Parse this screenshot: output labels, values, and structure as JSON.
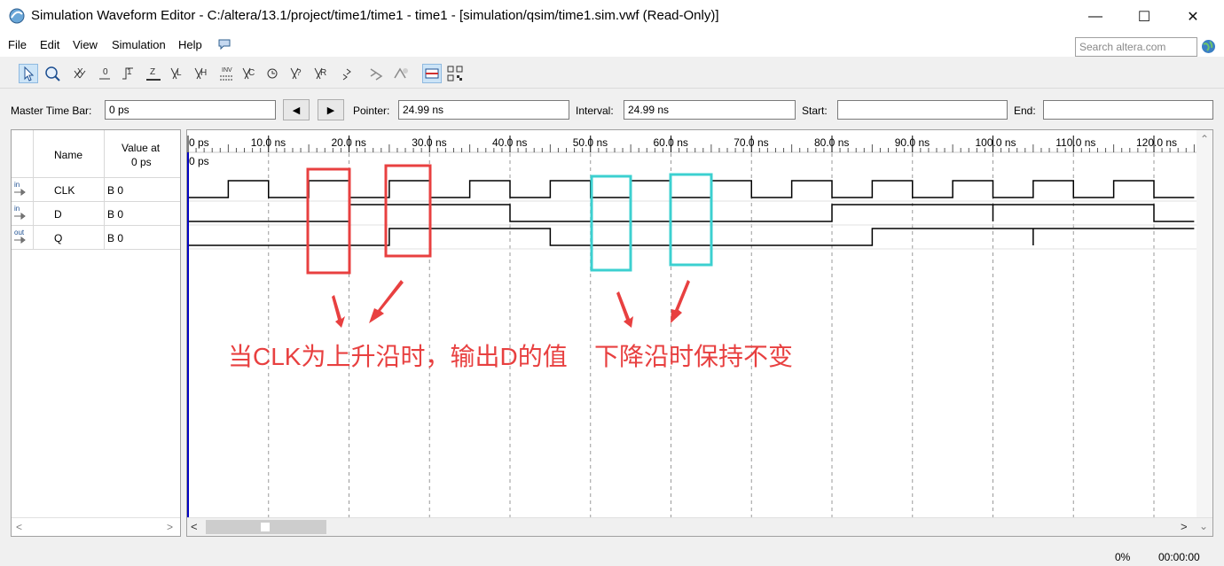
{
  "window": {
    "title": "Simulation Waveform Editor - C:/altera/13.1/project/time1/time1 - time1 - [simulation/qsim/time1.sim.vwf (Read-Only)]",
    "minimize": "—",
    "maximize": "☐",
    "close": "✕"
  },
  "menu": {
    "file": "File",
    "edit": "Edit",
    "view": "View",
    "simulation": "Simulation",
    "help": "Help",
    "search_placeholder": "Search altera.com"
  },
  "toolbar": {
    "icons": [
      "select-icon",
      "zoom-icon",
      "force-unknown-icon",
      "force-low-icon",
      "force-high-icon",
      "force-high-z-icon",
      "force-weak-low-icon",
      "force-weak-high-icon",
      "invert-icon",
      "count-value-icon",
      "clock-icon",
      "random-icon",
      "arbitrary-value-icon",
      "functional-sim-icon",
      "timing-sim-icon",
      "netlist-icon",
      "snap-to-grid-icon",
      "grid-icon"
    ],
    "texts": [
      "X",
      "0",
      "1",
      "Z",
      "L",
      "H",
      "INV",
      "C",
      "?",
      "R"
    ]
  },
  "timebar": {
    "master_label": "Master Time Bar:",
    "master_value": "0 ps",
    "prev": "◀",
    "next": "▶",
    "pointer_label": "Pointer:",
    "pointer_value": "24.99 ns",
    "interval_label": "Interval:",
    "interval_value": "24.99 ns",
    "start_label": "Start:",
    "start_value": "",
    "end_label": "End:",
    "end_value": ""
  },
  "signal_table": {
    "header_name": "Name",
    "header_value_line1": "Value at",
    "header_value_line2": "0 ps",
    "rows": [
      {
        "dir": "in",
        "name": "CLK",
        "value": "B 0"
      },
      {
        "dir": "in",
        "name": "D",
        "value": "B 0"
      },
      {
        "dir": "out",
        "name": "Q",
        "value": "B 0"
      }
    ]
  },
  "waveform": {
    "time_labels": [
      "0 ps",
      "10.0 ns",
      "20.0 ns",
      "30.0 ns",
      "40.0 ns",
      "50.0 ns",
      "60.0 ns",
      "70.0 ns",
      "80.0 ns",
      "90.0 ns",
      "100.0 ns",
      "110.0 ns",
      "120.0 ns"
    ],
    "cursor_label": "0 ps",
    "time_unit": "ns",
    "time_max": 125,
    "signals": {
      "CLK": [
        [
          0,
          0
        ],
        [
          5,
          1
        ],
        [
          10,
          0
        ],
        [
          15,
          1
        ],
        [
          20,
          0
        ],
        [
          25,
          1
        ],
        [
          30,
          0
        ],
        [
          35,
          1
        ],
        [
          40,
          0
        ],
        [
          45,
          1
        ],
        [
          50,
          0
        ],
        [
          55,
          1
        ],
        [
          60,
          0
        ],
        [
          65,
          1
        ],
        [
          70,
          0
        ],
        [
          75,
          1
        ],
        [
          80,
          0
        ],
        [
          85,
          1
        ],
        [
          90,
          0
        ],
        [
          95,
          1
        ],
        [
          100,
          0
        ],
        [
          105,
          1
        ],
        [
          110,
          0
        ],
        [
          115,
          1
        ],
        [
          120,
          0
        ],
        [
          125,
          0
        ]
      ],
      "D": [
        [
          0,
          0
        ],
        [
          20,
          1
        ],
        [
          40,
          0
        ],
        [
          80,
          1
        ],
        [
          100,
          0
        ],
        [
          100,
          1
        ],
        [
          120,
          0
        ],
        [
          125,
          0
        ]
      ],
      "Q": [
        [
          0,
          0
        ],
        [
          25,
          1
        ],
        [
          45,
          0
        ],
        [
          85,
          1
        ],
        [
          105,
          0
        ],
        [
          105,
          1
        ],
        [
          125,
          1
        ]
      ]
    }
  },
  "annotations": {
    "left_text": "当CLK为上升沿时，输出D的值",
    "right_text": "下降沿时保持不变",
    "red_color": "#e84040",
    "cyan_color": "#3cd0d0"
  },
  "status": {
    "progress": "0%",
    "elapsed": "00:00:00"
  }
}
